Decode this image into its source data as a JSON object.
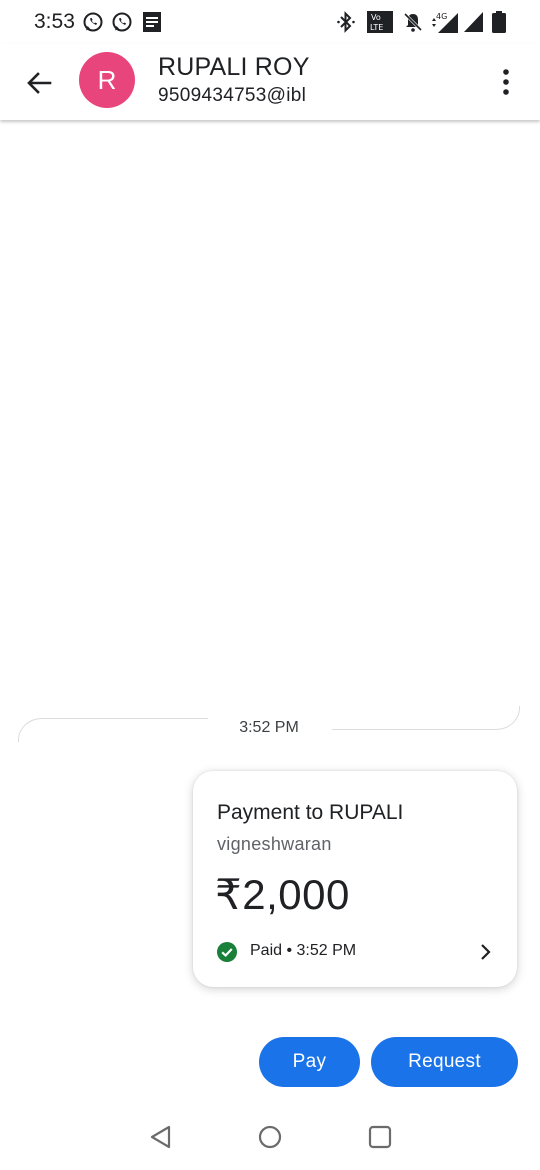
{
  "status_bar": {
    "time": "3:53",
    "left_icons": [
      "whatsapp-icon",
      "whatsapp-icon",
      "document-icon"
    ],
    "right_icons": [
      "bluetooth-icon",
      "volte-icon",
      "notifications-off-icon",
      "signal-4g-icon",
      "signal-icon",
      "battery-icon"
    ],
    "network_label": "4G"
  },
  "header": {
    "avatar_letter": "R",
    "avatar_color": "#e8457c",
    "contact_name": "RUPALI ROY",
    "contact_upi": "9509434753@ibl"
  },
  "conversation": {
    "timestamp": "3:52 PM",
    "payment_card": {
      "title": "Payment to RUPALI",
      "note": "vigneshwaran",
      "amount": "₹2,000",
      "status": "Paid • 3:52 PM",
      "status_color": "#188038"
    }
  },
  "actions": {
    "pay_label": "Pay",
    "request_label": "Request",
    "accent_color": "#1a73e8"
  },
  "nav_bar": {
    "icons": [
      "back-triangle-icon",
      "home-circle-icon",
      "recents-square-icon"
    ]
  }
}
